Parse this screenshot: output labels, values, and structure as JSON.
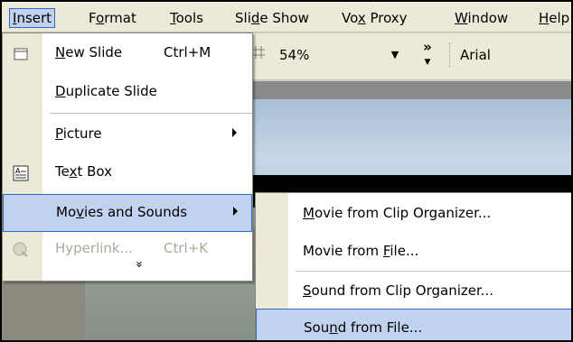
{
  "menubar": {
    "items": [
      {
        "name": "Insert",
        "pre": "",
        "key": "I",
        "post": "nsert"
      },
      {
        "name": "Format",
        "pre": "F",
        "key": "o",
        "post": "rmat"
      },
      {
        "name": "Tools",
        "pre": "",
        "key": "T",
        "post": "ools"
      },
      {
        "name": "Slide Show",
        "pre": "Sli",
        "key": "d",
        "post": "e Show"
      },
      {
        "name": "Vox Proxy",
        "pre": "Vo",
        "key": "x",
        "post": " Proxy"
      },
      {
        "name": "Window",
        "pre": "",
        "key": "W",
        "post": "indow"
      },
      {
        "name": "Help",
        "pre": "",
        "key": "H",
        "post": "elp"
      }
    ]
  },
  "toolbar": {
    "zoom_value": "54%",
    "font_name": "Arial",
    "overflow_glyph": "»"
  },
  "insert_menu": {
    "new_slide": {
      "pre": "",
      "key": "N",
      "post": "ew Slide",
      "shortcut": "Ctrl+M"
    },
    "duplicate_slide": {
      "pre": "",
      "key": "D",
      "post": "uplicate Slide"
    },
    "picture": {
      "pre": "",
      "key": "P",
      "post": "icture"
    },
    "text_box": {
      "pre": "Te",
      "key": "x",
      "post": "t Box"
    },
    "movies_and_sounds": {
      "pre": "Mo",
      "key": "v",
      "post": "ies and Sounds"
    },
    "hyperlink": {
      "label": "Hyperlink...",
      "shortcut": "Ctrl+K"
    },
    "more_glyph": "»"
  },
  "movies_submenu": {
    "items": [
      {
        "pre": "",
        "key": "M",
        "post": "ovie from Clip Organizer..."
      },
      {
        "pre": "Movie from ",
        "key": "F",
        "post": "ile..."
      },
      {
        "pre": "",
        "key": "S",
        "post": "ound from Clip Organizer..."
      },
      {
        "pre": "Sou",
        "key": "n",
        "post": "d from File..."
      }
    ]
  },
  "colors": {
    "highlight_fill": "#c1d2ee",
    "highlight_border": "#316ac5",
    "menu_bar": "#ece9d8"
  }
}
